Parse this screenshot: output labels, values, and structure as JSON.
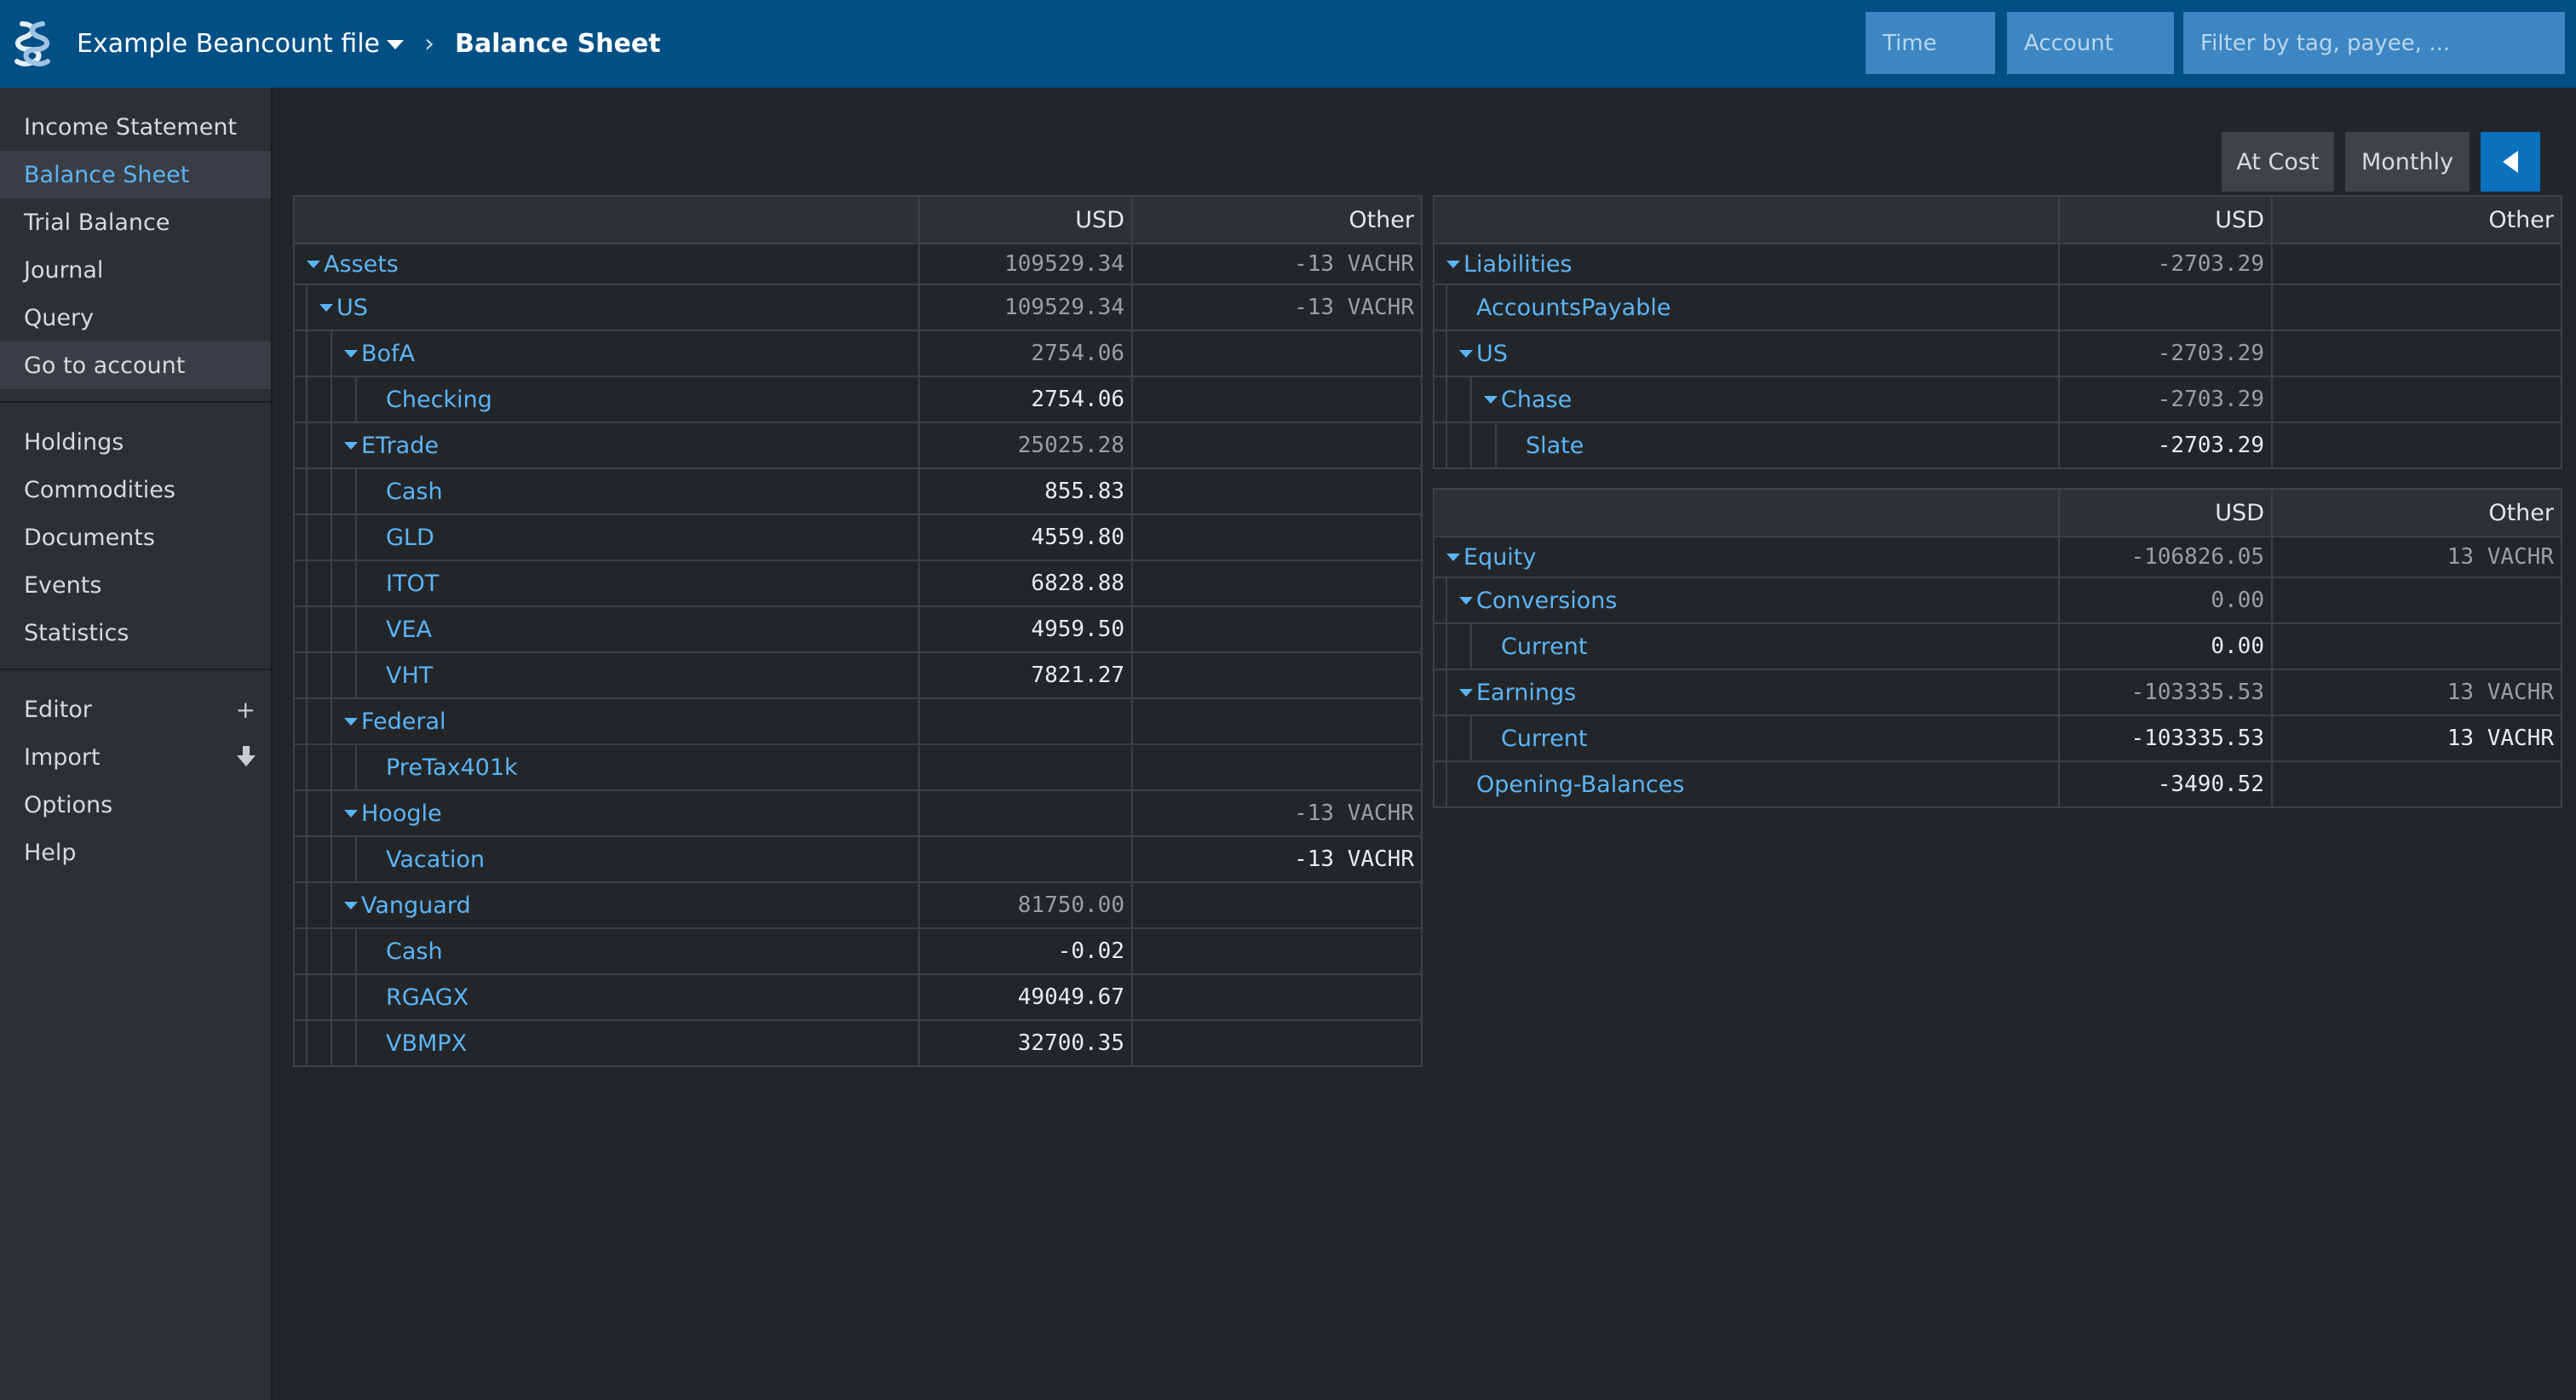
{
  "header": {
    "file_title": "Example Beancount file",
    "crumb_separator": "›",
    "page_title": "Balance Sheet",
    "time_placeholder": "Time",
    "account_placeholder": "Account",
    "filter_placeholder": "Filter by tag, payee, ..."
  },
  "sidebar": {
    "group1": [
      "Income Statement",
      "Balance Sheet",
      "Trial Balance",
      "Journal",
      "Query",
      "Go to account"
    ],
    "group2": [
      "Holdings",
      "Commodities",
      "Documents",
      "Events",
      "Statistics"
    ],
    "group3": [
      "Editor",
      "Import",
      "Options",
      "Help"
    ],
    "active": "Balance Sheet",
    "editor_icon": "plus-icon",
    "import_icon": "download-icon"
  },
  "toolbar": {
    "at_cost": "At Cost",
    "monthly": "Monthly",
    "collapse_icon": "triangle-left-icon"
  },
  "columns": {
    "usd": "USD",
    "other": "Other"
  },
  "assets": [
    {
      "name": "Assets",
      "depth": 0,
      "toggle": true,
      "usd": "109529.34",
      "other": "-13 VACHR",
      "dim": true
    },
    {
      "name": "US",
      "depth": 1,
      "toggle": true,
      "usd": "109529.34",
      "other": "-13 VACHR",
      "dim": true
    },
    {
      "name": "BofA",
      "depth": 2,
      "toggle": true,
      "usd": "2754.06",
      "other": "",
      "dim": true
    },
    {
      "name": "Checking",
      "depth": 3,
      "toggle": false,
      "usd": "2754.06",
      "other": "",
      "dim": false
    },
    {
      "name": "ETrade",
      "depth": 2,
      "toggle": true,
      "usd": "25025.28",
      "other": "",
      "dim": true
    },
    {
      "name": "Cash",
      "depth": 3,
      "toggle": false,
      "usd": "855.83",
      "other": "",
      "dim": false
    },
    {
      "name": "GLD",
      "depth": 3,
      "toggle": false,
      "usd": "4559.80",
      "other": "",
      "dim": false
    },
    {
      "name": "ITOT",
      "depth": 3,
      "toggle": false,
      "usd": "6828.88",
      "other": "",
      "dim": false
    },
    {
      "name": "VEA",
      "depth": 3,
      "toggle": false,
      "usd": "4959.50",
      "other": "",
      "dim": false
    },
    {
      "name": "VHT",
      "depth": 3,
      "toggle": false,
      "usd": "7821.27",
      "other": "",
      "dim": false
    },
    {
      "name": "Federal",
      "depth": 2,
      "toggle": true,
      "usd": "",
      "other": "",
      "dim": true
    },
    {
      "name": "PreTax401k",
      "depth": 3,
      "toggle": false,
      "usd": "",
      "other": "",
      "dim": false
    },
    {
      "name": "Hoogle",
      "depth": 2,
      "toggle": true,
      "usd": "",
      "other": "-13 VACHR",
      "dim": true
    },
    {
      "name": "Vacation",
      "depth": 3,
      "toggle": false,
      "usd": "",
      "other": "-13 VACHR",
      "dim": false
    },
    {
      "name": "Vanguard",
      "depth": 2,
      "toggle": true,
      "usd": "81750.00",
      "other": "",
      "dim": true
    },
    {
      "name": "Cash",
      "depth": 3,
      "toggle": false,
      "usd": "-0.02",
      "other": "",
      "dim": false
    },
    {
      "name": "RGAGX",
      "depth": 3,
      "toggle": false,
      "usd": "49049.67",
      "other": "",
      "dim": false
    },
    {
      "name": "VBMPX",
      "depth": 3,
      "toggle": false,
      "usd": "32700.35",
      "other": "",
      "dim": false
    }
  ],
  "liabilities": [
    {
      "name": "Liabilities",
      "depth": 0,
      "toggle": true,
      "usd": "-2703.29",
      "other": "",
      "dim": true
    },
    {
      "name": "AccountsPayable",
      "depth": 1,
      "toggle": false,
      "usd": "",
      "other": "",
      "dim": false
    },
    {
      "name": "US",
      "depth": 1,
      "toggle": true,
      "usd": "-2703.29",
      "other": "",
      "dim": true
    },
    {
      "name": "Chase",
      "depth": 2,
      "toggle": true,
      "usd": "-2703.29",
      "other": "",
      "dim": true
    },
    {
      "name": "Slate",
      "depth": 3,
      "toggle": false,
      "usd": "-2703.29",
      "other": "",
      "dim": false
    }
  ],
  "equity": [
    {
      "name": "Equity",
      "depth": 0,
      "toggle": true,
      "usd": "-106826.05",
      "other": "13 VACHR",
      "dim": true
    },
    {
      "name": "Conversions",
      "depth": 1,
      "toggle": true,
      "usd": "0.00",
      "other": "",
      "dim": true
    },
    {
      "name": "Current",
      "depth": 2,
      "toggle": false,
      "usd": "0.00",
      "other": "",
      "dim": false
    },
    {
      "name": "Earnings",
      "depth": 1,
      "toggle": true,
      "usd": "-103335.53",
      "other": "13 VACHR",
      "dim": true
    },
    {
      "name": "Current",
      "depth": 2,
      "toggle": false,
      "usd": "-103335.53",
      "other": "13 VACHR",
      "dim": false
    },
    {
      "name": "Opening-Balances",
      "depth": 1,
      "toggle": false,
      "usd": "-3490.52",
      "other": "",
      "dim": false
    }
  ]
}
